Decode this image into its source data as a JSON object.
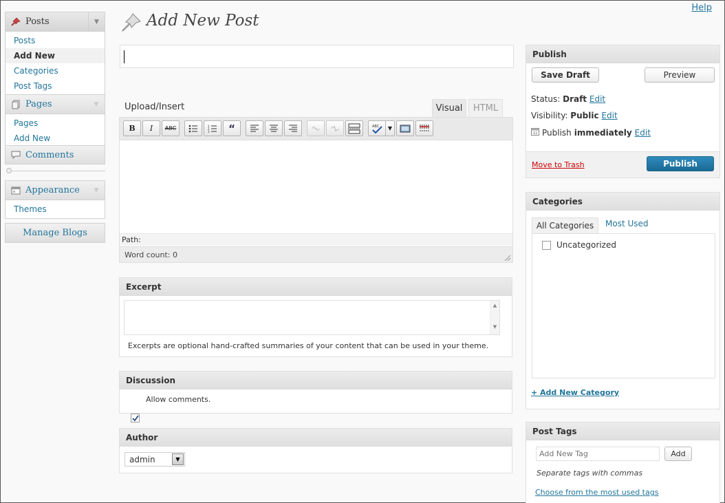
{
  "menu": {
    "posts": {
      "label": "Posts",
      "items": [
        "Posts",
        "Add New",
        "Categories",
        "Post Tags"
      ]
    },
    "pages": {
      "label": "Pages",
      "items": [
        "Pages",
        "Add New"
      ]
    },
    "comments": {
      "label": "Comments"
    },
    "appearance": {
      "label": "Appearance",
      "items": [
        "Themes"
      ]
    },
    "manage_blogs": "Manage Blogs"
  },
  "header": {
    "title": "Add New Post",
    "help": "Help"
  },
  "editor": {
    "title_value": "",
    "upload_insert": "Upload/Insert",
    "tab_visual": "Visual",
    "tab_html": "HTML",
    "path_label": "Path:",
    "word_count": "Word count: 0",
    "toolbar": [
      "bold-icon",
      "italic-icon",
      "strikethrough-icon",
      "unordered-list-icon",
      "ordered-list-icon",
      "blockquote-icon",
      "align-left-icon",
      "align-center-icon",
      "align-right-icon",
      "link-icon",
      "unlink-icon",
      "more-tag-icon",
      "spellcheck-icon",
      "fullscreen-icon",
      "kitchen-sink-icon"
    ]
  },
  "excerpt": {
    "title": "Excerpt",
    "value": "",
    "help": "Excerpts are optional hand-crafted summaries of your content that can be used in your theme."
  },
  "discussion": {
    "title": "Discussion",
    "allow_comments": "Allow comments.",
    "allow_checked": true
  },
  "author": {
    "title": "Author",
    "selected": "admin"
  },
  "publish": {
    "title": "Publish",
    "save_draft": "Save Draft",
    "preview": "Preview",
    "status_label": "Status:",
    "status_value": "Draft",
    "visibility_label": "Visibility:",
    "visibility_value": "Public",
    "publish_label": "Publish",
    "publish_value": "immediately",
    "edit": "Edit",
    "move_to_trash": "Move to Trash",
    "publish_button": "Publish"
  },
  "categories": {
    "title": "Categories",
    "tab_all": "All Categories",
    "tab_most_used": "Most Used",
    "items": [
      "Uncategorized"
    ],
    "add_new": "+ Add New Category"
  },
  "tags": {
    "title": "Post Tags",
    "placeholder": "Add New Tag",
    "add": "Add",
    "hint": "Separate tags with commas",
    "choose": "Choose from the most used tags"
  },
  "colors": {
    "link": "#21759b",
    "publish_button": "#21759b",
    "trash": "#cc0000"
  }
}
